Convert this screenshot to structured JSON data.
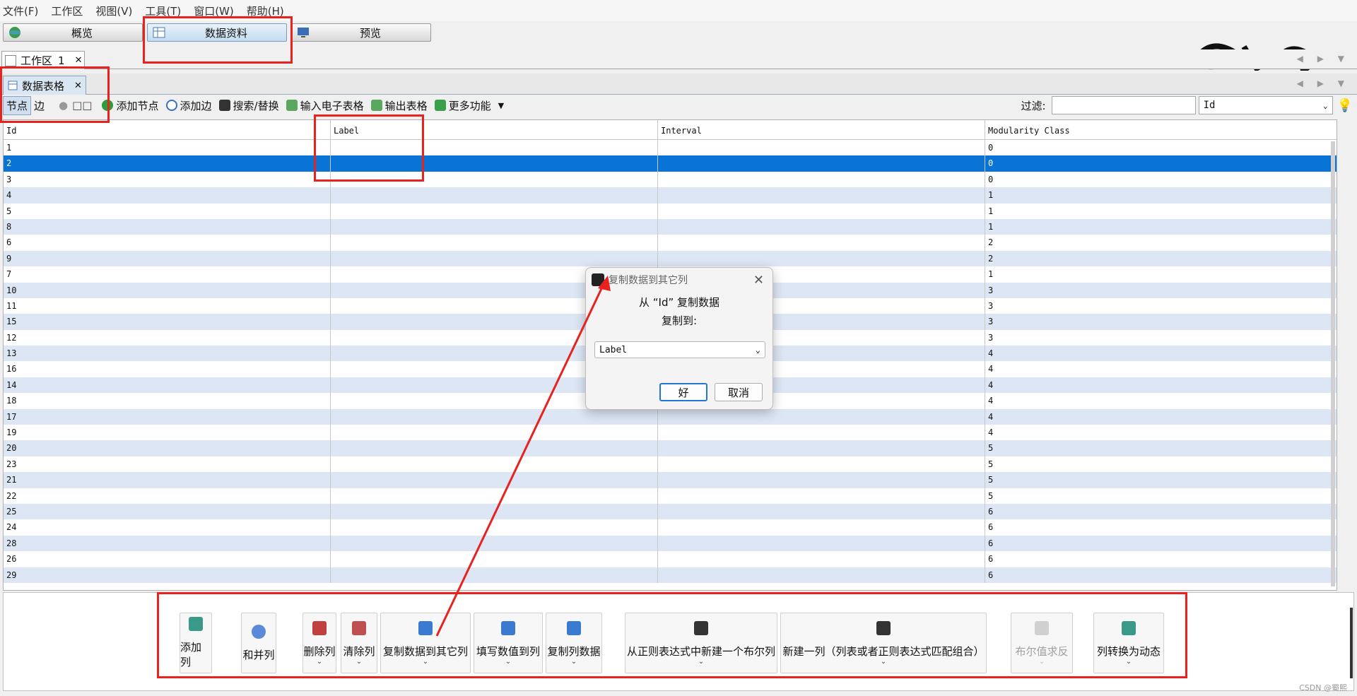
{
  "menu": [
    "文件(F)",
    "工作区",
    "视图(V)",
    "工具(T)",
    "窗口(W)",
    "帮助(H)"
  ],
  "modes": {
    "overview": "概览",
    "data_lab": "数据资料",
    "preview": "预览"
  },
  "workspace_tab": {
    "label": "工作区",
    "number": "1",
    "close": "✕"
  },
  "data_table_tab": {
    "label": "数据表格",
    "close": "✕"
  },
  "toolbar": {
    "nodes": "节点",
    "edges": "边",
    "add_node": "添加节点",
    "add_edge": "添加边",
    "search_replace": "搜索/替换",
    "import_spreadsheet": "输入电子表格",
    "export_table": "输出表格",
    "more": "更多功能",
    "filter_label": "过滤:",
    "filter_value": "",
    "filter_column": "Id"
  },
  "table": {
    "headers": [
      "Id",
      "Label",
      "Interval",
      "Modularity Class"
    ],
    "selected_index": 1,
    "rows": [
      [
        "1",
        "",
        "",
        "0"
      ],
      [
        "2",
        "",
        "",
        "0"
      ],
      [
        "3",
        "",
        "",
        "0"
      ],
      [
        "4",
        "",
        "",
        "1"
      ],
      [
        "5",
        "",
        "",
        "1"
      ],
      [
        "8",
        "",
        "",
        "1"
      ],
      [
        "6",
        "",
        "",
        "2"
      ],
      [
        "9",
        "",
        "",
        "2"
      ],
      [
        "7",
        "",
        "",
        "1"
      ],
      [
        "10",
        "",
        "",
        "3"
      ],
      [
        "11",
        "",
        "",
        "3"
      ],
      [
        "15",
        "",
        "",
        "3"
      ],
      [
        "12",
        "",
        "",
        "3"
      ],
      [
        "13",
        "",
        "",
        "4"
      ],
      [
        "16",
        "",
        "",
        "4"
      ],
      [
        "14",
        "",
        "",
        "4"
      ],
      [
        "18",
        "",
        "",
        "4"
      ],
      [
        "17",
        "",
        "",
        "4"
      ],
      [
        "19",
        "",
        "",
        "4"
      ],
      [
        "20",
        "",
        "",
        "5"
      ],
      [
        "23",
        "",
        "",
        "5"
      ],
      [
        "21",
        "",
        "",
        "5"
      ],
      [
        "22",
        "",
        "",
        "5"
      ],
      [
        "25",
        "",
        "",
        "6"
      ],
      [
        "24",
        "",
        "",
        "6"
      ],
      [
        "28",
        "",
        "",
        "6"
      ],
      [
        "26",
        "",
        "",
        "6"
      ],
      [
        "29",
        "",
        "",
        "6"
      ]
    ]
  },
  "bottom_buttons": {
    "add_column": "添加列",
    "merge_columns": "和并列",
    "delete_column": "删除列",
    "clear_column": "清除列",
    "copy_to_other": "复制数据到其它列",
    "fill_values": "填写数值到列",
    "duplicate_column": "复制列数据",
    "regex_boolean": "从正则表达式中新建一个布尔列",
    "regex_new_column": "新建一列（列表或者正则表达式匹配组合）",
    "negate_boolean": "布尔值求反",
    "to_dynamic": "列转换为动态",
    "chevron": "⌄"
  },
  "dialog": {
    "title": "复制数据到其它列",
    "from_text": "从 “Id” 复制数据",
    "to_text": "复制到:",
    "target": "Label",
    "ok": "好",
    "cancel": "取消"
  },
  "watermark": "CSDN @蜀熙",
  "colors": {
    "selection": "#0a74d6",
    "stripe": "#dde6f4",
    "highlight": "#e8231f"
  }
}
